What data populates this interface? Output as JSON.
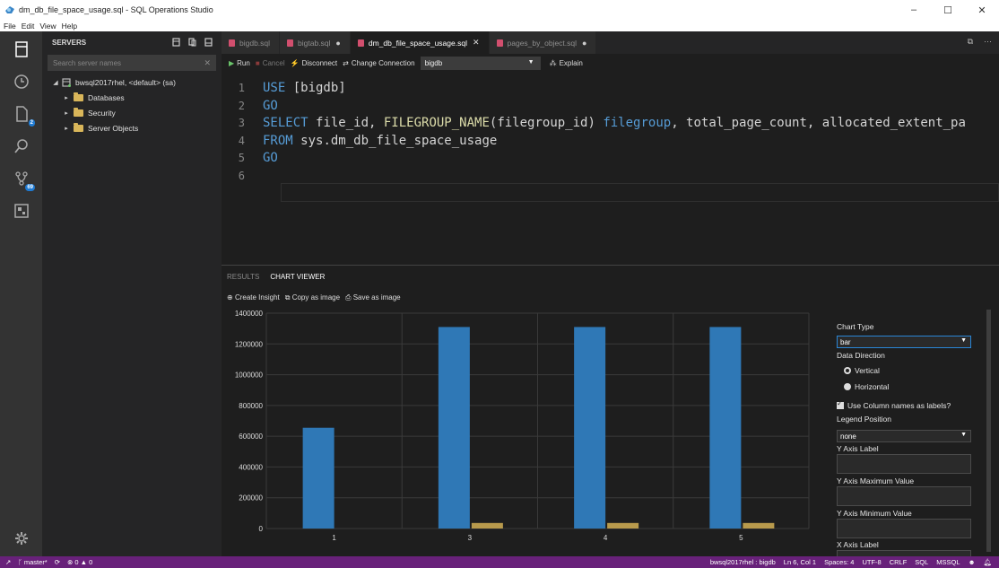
{
  "window": {
    "title": "dm_db_file_space_usage.sql - SQL Operations Studio",
    "controls": [
      "–",
      "☐",
      "✕"
    ]
  },
  "menu": [
    "File",
    "Edit",
    "View",
    "Help"
  ],
  "activity_bar": {
    "icons": [
      "servers-icon",
      "history-icon",
      "explorer-icon",
      "search-icon",
      "source-control-icon",
      "extensions-icon"
    ],
    "explorer_badge": "2",
    "source_control_badge": "69"
  },
  "sidebar": {
    "title": "SERVERS",
    "search_placeholder": "Search server names",
    "tree": [
      {
        "label": "bwsql2017rhel, <default> (sa)",
        "level": 0,
        "expanded": true
      },
      {
        "label": "Databases",
        "level": 1
      },
      {
        "label": "Security",
        "level": 1
      },
      {
        "label": "Server Objects",
        "level": 1
      }
    ]
  },
  "tabs": [
    {
      "label": "bigdb.sql",
      "dirty": false,
      "active": false
    },
    {
      "label": "bigtab.sql",
      "dirty": true,
      "active": false
    },
    {
      "label": "dm_db_file_space_usage.sql",
      "dirty": false,
      "active": true
    },
    {
      "label": "pages_by_object.sql",
      "dirty": true,
      "active": false
    }
  ],
  "toolbar": {
    "run": "Run",
    "cancel": "Cancel",
    "disconnect": "Disconnect",
    "change_connection": "Change Connection",
    "database": "bigdb",
    "explain": "Explain"
  },
  "editor": {
    "lines": [
      {
        "n": "1",
        "parts": [
          [
            "kw",
            "USE "
          ],
          [
            "",
            "[bigdb]"
          ]
        ]
      },
      {
        "n": "2",
        "parts": [
          [
            "kw",
            "GO"
          ]
        ]
      },
      {
        "n": "3",
        "parts": [
          [
            "kw",
            "SELECT "
          ],
          [
            "",
            "file_id, "
          ],
          [
            "fn",
            "FILEGROUP_NAME"
          ],
          [
            "",
            "(filegroup_id) "
          ],
          [
            "kw",
            "filegroup"
          ],
          [
            "",
            ", total_page_count, allocated_extent_pa"
          ]
        ]
      },
      {
        "n": "4",
        "parts": [
          [
            "kw",
            "FROM "
          ],
          [
            "",
            "sys.dm_db_file_space_usage"
          ]
        ]
      },
      {
        "n": "5",
        "parts": [
          [
            "kw",
            "GO"
          ]
        ]
      },
      {
        "n": "6",
        "parts": []
      }
    ]
  },
  "panel": {
    "tabs": [
      "RESULTS",
      "CHART VIEWER"
    ],
    "actions": [
      "Create Insight",
      "Copy as image",
      "Save as image"
    ]
  },
  "chart_data": {
    "type": "bar",
    "categories": [
      "1",
      "3",
      "4",
      "5"
    ],
    "series": [
      {
        "values": [
          655000,
          1310000,
          1310000,
          1310000
        ],
        "color": "#2f78b6"
      },
      {
        "values": [
          0,
          36000,
          36000,
          36000
        ],
        "color": "#b89a4c"
      }
    ],
    "ylim": [
      0,
      1400000
    ],
    "yticks": [
      "0",
      "200000",
      "400000",
      "600000",
      "800000",
      "1000000",
      "1200000",
      "1400000"
    ],
    "grid": true,
    "legend": "none"
  },
  "chart_options": {
    "chart_type_label": "Chart Type",
    "chart_type_value": "bar",
    "data_direction_label": "Data Direction",
    "vertical": "Vertical",
    "horizontal": "Horizontal",
    "use_column_names": "Use Column names as labels?",
    "legend_position_label": "Legend Position",
    "legend_position_value": "none",
    "y_axis_label": "Y Axis Label",
    "y_axis_max": "Y Axis Maximum Value",
    "y_axis_min": "Y Axis Minimum Value",
    "x_axis_label": "X Axis Label"
  },
  "status": {
    "branch": "master*",
    "errors": "0",
    "warnings": "0",
    "connection": "bwsql2017rhel : bigdb",
    "position": "Ln 6, Col 1",
    "spaces": "Spaces: 4",
    "encoding": "UTF-8",
    "eol": "CRLF",
    "language": "SQL",
    "provider": "MSSQL"
  },
  "colors": {
    "status_bar": "#68217a",
    "bar_primary": "#2f78b6",
    "bar_secondary": "#b89a4c"
  }
}
